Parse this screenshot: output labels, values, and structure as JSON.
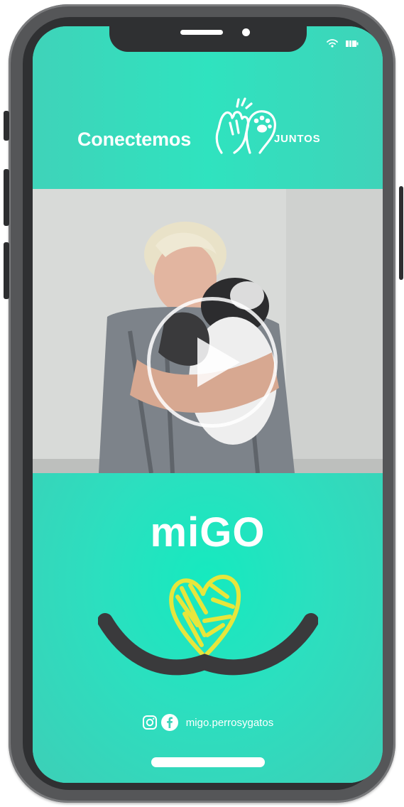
{
  "header": {
    "brand_word": "Conectemos",
    "brand_sub": "JUNTOS"
  },
  "video": {
    "description_icon": "play-icon"
  },
  "logo": {
    "name": "miGO"
  },
  "social": {
    "handle": "migo.perrosygatos",
    "icons": [
      "instagram-icon",
      "facebook-icon"
    ]
  },
  "colors": {
    "teal": "#3fd3b9",
    "heart": "#e6e63c",
    "smile": "#3a3a3c"
  }
}
